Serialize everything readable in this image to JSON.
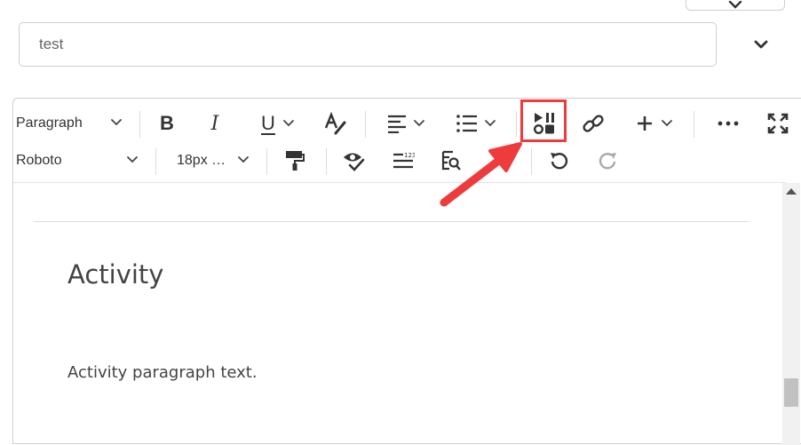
{
  "title_input": {
    "value": "test"
  },
  "toolbar": {
    "block_format": "Paragraph",
    "font_family": "Roboto",
    "font_size": "18px …",
    "icons": {
      "bold": "B",
      "italic": "I",
      "underline": "U"
    }
  },
  "content": {
    "heading": "Activity",
    "paragraph": "Activity paragraph text."
  },
  "colors": {
    "highlight": "#ee3b3b",
    "border": "#cfcfcf",
    "text": "#333333"
  }
}
